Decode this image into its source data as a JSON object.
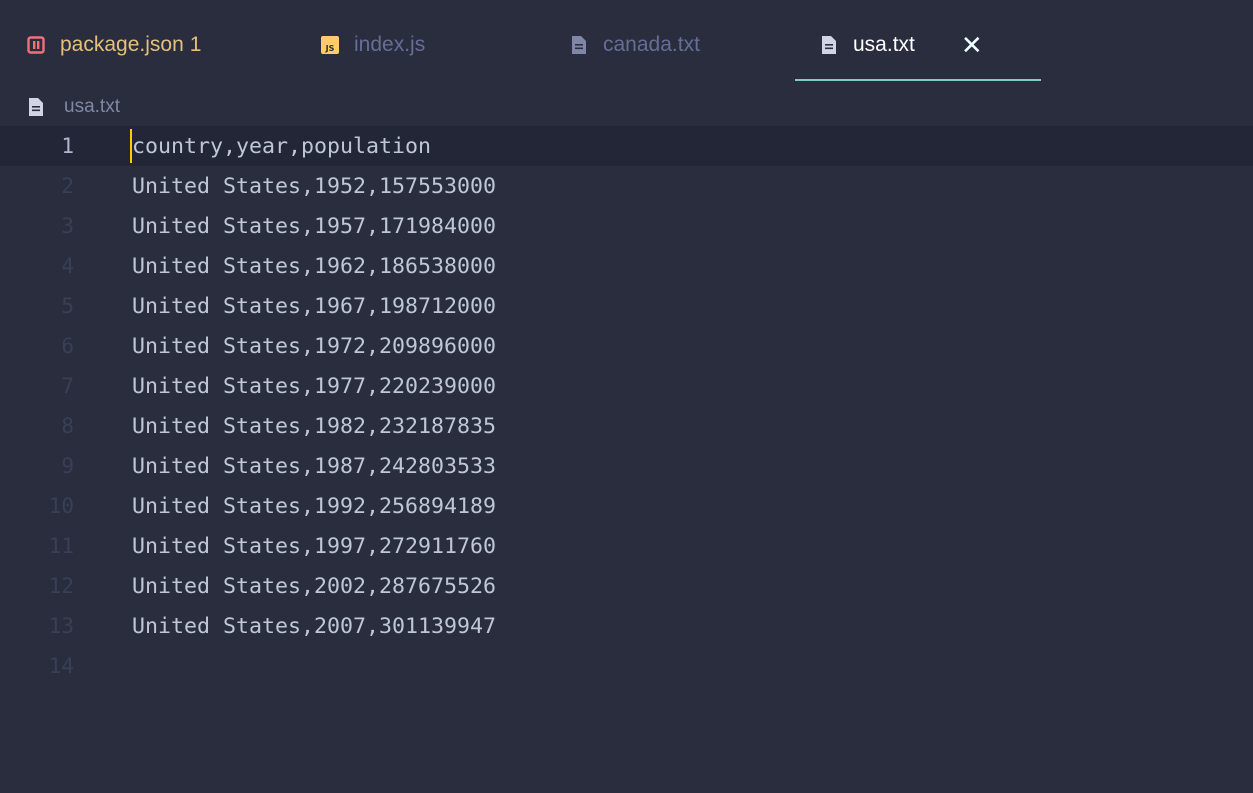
{
  "tabs": [
    {
      "label": "package.json",
      "badge": "1",
      "icon": "json-file-icon",
      "color": "#e5c07b",
      "icon_color": "#f07178"
    },
    {
      "label": "index.js",
      "badge": "",
      "icon": "js-file-icon",
      "color": "#676e95",
      "icon_color": "#ffcb6b"
    },
    {
      "label": "canada.txt",
      "badge": "",
      "icon": "text-file-icon",
      "color": "#676e95",
      "icon_color": "#8087a6"
    },
    {
      "label": "usa.txt",
      "badge": "",
      "icon": "text-file-icon",
      "color": "#ffffff",
      "icon_color": "#d0d4e4",
      "active": true,
      "close": "✕"
    }
  ],
  "breadcrumb": {
    "label": "usa.txt",
    "icon": "text-file-icon"
  },
  "editor": {
    "current_line": 1,
    "lines": [
      {
        "n": "1",
        "text": "country,year,population"
      },
      {
        "n": "2",
        "text": "United States,1952,157553000"
      },
      {
        "n": "3",
        "text": "United States,1957,171984000"
      },
      {
        "n": "4",
        "text": "United States,1962,186538000"
      },
      {
        "n": "5",
        "text": "United States,1967,198712000"
      },
      {
        "n": "6",
        "text": "United States,1972,209896000"
      },
      {
        "n": "7",
        "text": "United States,1977,220239000"
      },
      {
        "n": "8",
        "text": "United States,1982,232187835"
      },
      {
        "n": "9",
        "text": "United States,1987,242803533"
      },
      {
        "n": "10",
        "text": "United States,1992,256894189"
      },
      {
        "n": "11",
        "text": "United States,1997,272911760"
      },
      {
        "n": "12",
        "text": "United States,2002,287675526"
      },
      {
        "n": "13",
        "text": "United States,2007,301139947"
      },
      {
        "n": "14",
        "text": ""
      }
    ]
  }
}
